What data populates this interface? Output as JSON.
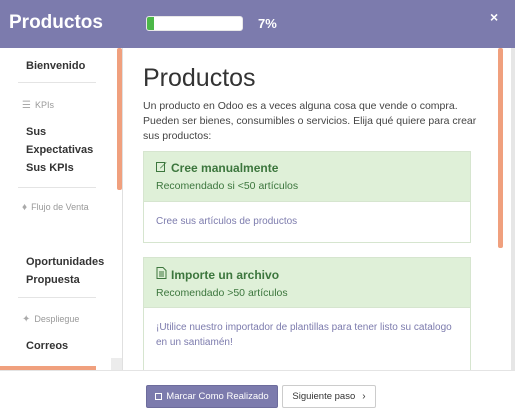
{
  "header": {
    "title": "Productos",
    "progress_percent": 7,
    "progress_label": "7%",
    "close_glyph": "×",
    "accent_color": "#7c7bad",
    "progress_color": "#4cb848"
  },
  "sidebar": {
    "items": {
      "bienvenido": "Bienvenido",
      "kpis_category": "KPIs",
      "sus_expectativas": "Sus Expectativas",
      "sus_kpis": "Sus KPIs",
      "flujo_category": "Flujo de Venta",
      "oportunidades": "Oportunidades",
      "propuesta": "Propuesta",
      "despliegue_category": "Despliegue",
      "correos": "Correos"
    },
    "icons": {
      "kpis": "trophy-icon",
      "flujo": "tag-icon",
      "despliegue": "magic-icon"
    }
  },
  "main": {
    "title": "Productos",
    "description": "Un producto en Odoo es a veces alguna cosa que vende o compra. Pueden ser bienes, consumibles o servicios. Elija qué quiere para crear sus productos:",
    "cards": [
      {
        "title": "Cree manualmente",
        "subtitle": "Recomendado si <50 artículos",
        "body": "Cree sus artículos de productos",
        "icon": "edit-icon"
      },
      {
        "title": "Importe un archivo",
        "subtitle": "Recomendado >50 artículos",
        "body": "¡Utilice nuestro importador de plantillas para tener listo su catalogo en un santiamén!",
        "icon": "file-import-icon"
      }
    ],
    "success_bg_color": "#dff0d8",
    "success_text_color": "#3c763d",
    "scrollbar_color": "#f0a07e"
  },
  "footer": {
    "mark_done_label": "Marcar Como Realizado",
    "next_step_label": "Siguiente paso",
    "next_icon": "chevron-right-icon"
  }
}
